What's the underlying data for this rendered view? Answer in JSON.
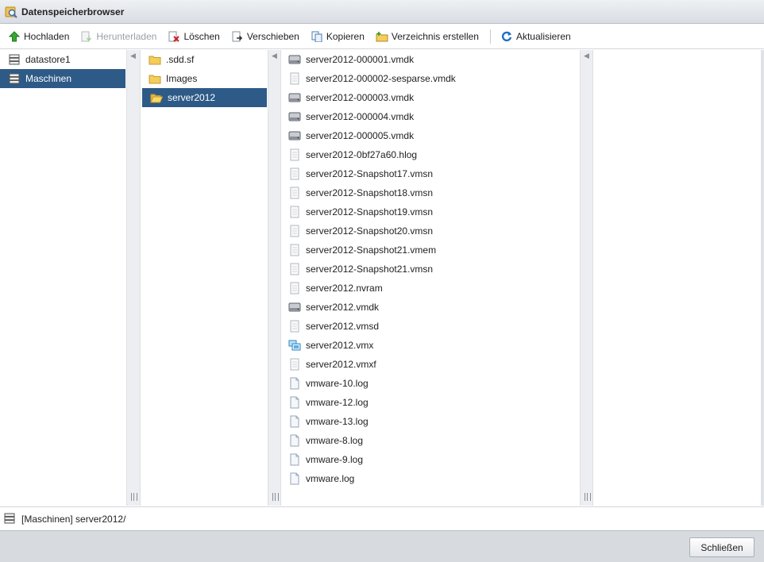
{
  "window": {
    "title": "Datenspeicherbrowser"
  },
  "toolbar": {
    "upload": "Hochladen",
    "download": "Herunterladen",
    "delete": "Löschen",
    "move": "Verschieben",
    "copy": "Kopieren",
    "mkdir": "Verzeichnis erstellen",
    "refresh": "Aktualisieren"
  },
  "datastores": [
    {
      "label": "datastore1",
      "selected": false
    },
    {
      "label": "Maschinen",
      "selected": true
    }
  ],
  "folders": [
    {
      "label": ".sdd.sf",
      "selected": false
    },
    {
      "label": "Images",
      "selected": false
    },
    {
      "label": "server2012",
      "selected": true
    }
  ],
  "files": [
    {
      "label": "server2012-000001.vmdk",
      "icon": "disk"
    },
    {
      "label": "server2012-000002-sesparse.vmdk",
      "icon": "file"
    },
    {
      "label": "server2012-000003.vmdk",
      "icon": "disk"
    },
    {
      "label": "server2012-000004.vmdk",
      "icon": "disk"
    },
    {
      "label": "server2012-000005.vmdk",
      "icon": "disk"
    },
    {
      "label": "server2012-0bf27a60.hlog",
      "icon": "file"
    },
    {
      "label": "server2012-Snapshot17.vmsn",
      "icon": "file"
    },
    {
      "label": "server2012-Snapshot18.vmsn",
      "icon": "file"
    },
    {
      "label": "server2012-Snapshot19.vmsn",
      "icon": "file"
    },
    {
      "label": "server2012-Snapshot20.vmsn",
      "icon": "file"
    },
    {
      "label": "server2012-Snapshot21.vmem",
      "icon": "file"
    },
    {
      "label": "server2012-Snapshot21.vmsn",
      "icon": "file"
    },
    {
      "label": "server2012.nvram",
      "icon": "file"
    },
    {
      "label": "server2012.vmdk",
      "icon": "disk"
    },
    {
      "label": "server2012.vmsd",
      "icon": "file"
    },
    {
      "label": "server2012.vmx",
      "icon": "vm"
    },
    {
      "label": "server2012.vmxf",
      "icon": "file"
    },
    {
      "label": "vmware-10.log",
      "icon": "log"
    },
    {
      "label": "vmware-12.log",
      "icon": "log"
    },
    {
      "label": "vmware-13.log",
      "icon": "log"
    },
    {
      "label": "vmware-8.log",
      "icon": "log"
    },
    {
      "label": "vmware-9.log",
      "icon": "log"
    },
    {
      "label": "vmware.log",
      "icon": "log"
    }
  ],
  "status": {
    "path": "[Maschinen] server2012/"
  },
  "footer": {
    "close": "Schließen"
  },
  "colors": {
    "selection": "#2e5a87",
    "footer_bg": "#d7dbe0"
  }
}
